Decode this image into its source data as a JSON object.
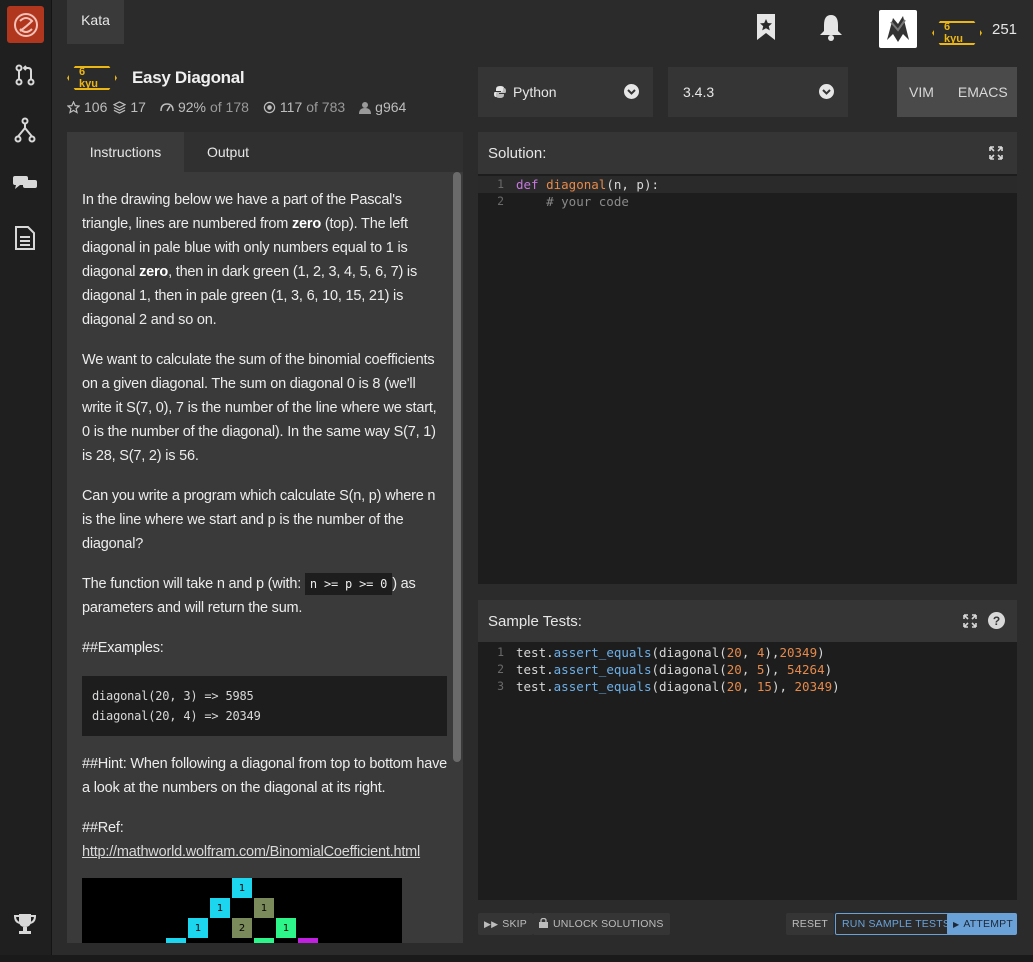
{
  "nav": {
    "kata_tab": "Kata",
    "user_honor": "251",
    "user_rank": "6 kyu"
  },
  "kata": {
    "rank": "6 kyu",
    "title": "Easy Diagonal",
    "stars": "106",
    "collections": "17",
    "satisfaction": "92%",
    "satisfaction_of": "of 178",
    "completed": "117",
    "completed_of": "of 783",
    "author": "g964"
  },
  "editor_controls": {
    "language": "Python",
    "version": "3.4.3",
    "mode_vim": "VIM",
    "mode_emacs": "EMACS"
  },
  "left_tabs": {
    "instructions": "Instructions",
    "output": "Output"
  },
  "description": {
    "p1_a": "In the drawing below we have a part of the Pascal's triangle, lines are numbered from ",
    "p1_zero1": "zero",
    "p1_b": " (top). The left diagonal in pale blue with only numbers equal to 1 is diagonal ",
    "p1_zero2": "zero",
    "p1_c": ", then in dark green (1, 2, 3, 4, 5, 6, 7) is diagonal 1, then in pale green (1, 3, 6, 10, 15, 21) is diagonal 2 and so on.",
    "p2": "We want to calculate the sum of the binomial coefficients on a given diagonal. The sum on diagonal 0 is 8 (we'll write it S(7, 0), 7 is the number of the line where we start, 0 is the number of the diagonal). In the same way S(7, 1) is 28, S(7, 2) is 56.",
    "p3": "Can you write a program which calculate S(n, p) where n is the line where we start and p is the number of the diagonal?",
    "p4_a": "The function will take n and p (with: ",
    "p4_code": "n >= p >= 0",
    "p4_b": ") as parameters and will return the sum.",
    "examples_heading": "##Examples:",
    "example_1": "diagonal(20, 3) => 5985",
    "example_2": "diagonal(20, 4) => 20349",
    "hint": "##Hint: When following a diagonal from top to bottom have a look at the numbers on the diagonal at its right.",
    "ref_heading": "##Ref:",
    "ref_link": "http://mathworld.wolfram.com/BinomialCoefficient.html"
  },
  "pascal_cells": [
    "1",
    "1",
    "1",
    "1",
    "2",
    "1"
  ],
  "solution": {
    "heading": "Solution:",
    "line_numbers": [
      "1",
      "2"
    ],
    "line1_kw": "def",
    "line1_fn": "diagonal",
    "line1_rest": "(n, p):",
    "line2": "    # your code"
  },
  "tests": {
    "heading": "Sample Tests:",
    "help": "?",
    "line_numbers": [
      "1",
      "2",
      "3"
    ],
    "t1": [
      "test",
      ".",
      "assert_equals",
      "(diagonal(",
      "20",
      ", ",
      "4",
      "),",
      "20349",
      ")"
    ],
    "t2": [
      "test",
      ".",
      "assert_equals",
      "(diagonal(",
      "20",
      ", ",
      "5",
      "), ",
      "54264",
      ")"
    ],
    "t3": [
      "test",
      ".",
      "assert_equals",
      "(diagonal(",
      "20",
      ", ",
      "15",
      "), ",
      "20349",
      ")"
    ]
  },
  "actions": {
    "skip": "SKIP",
    "unlock": "UNLOCK SOLUTIONS",
    "reset": "RESET",
    "run_tests": "RUN SAMPLE TESTS",
    "attempt": "ATTEMPT"
  },
  "colors": {
    "brand": "#b1361e",
    "kyu_yellow": "#ecb613",
    "accent_blue": "#6aa2d8"
  }
}
